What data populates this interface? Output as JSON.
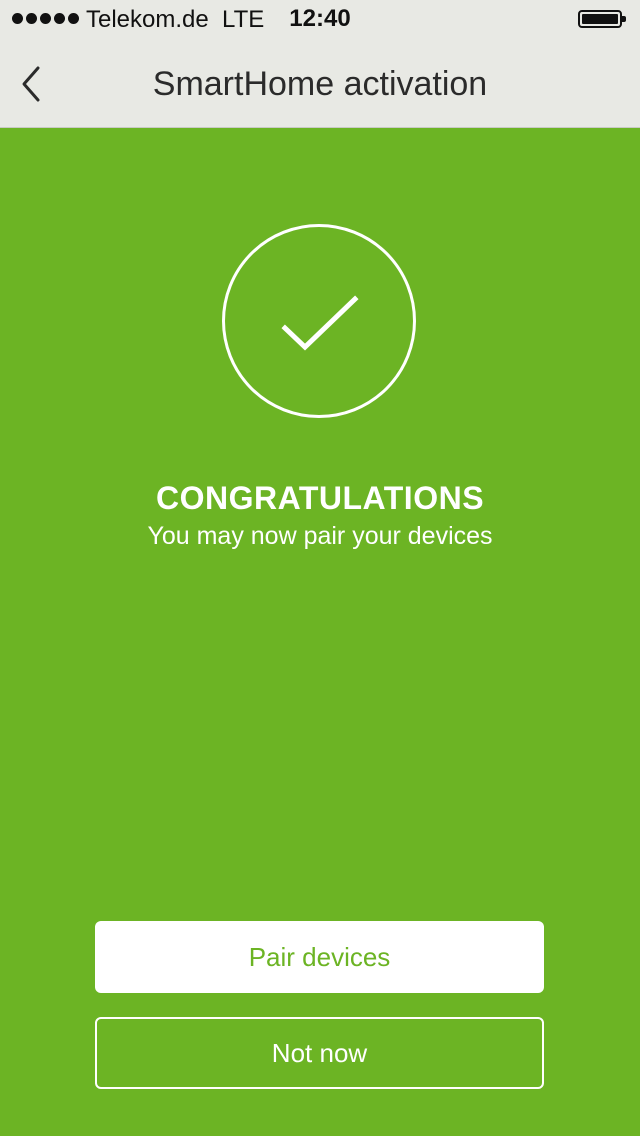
{
  "status_bar": {
    "carrier": "Telekom.de",
    "network": "LTE",
    "time": "12:40",
    "signal_bars": 5,
    "battery_level": 1.0
  },
  "nav": {
    "title": "SmartHome activation",
    "back_icon": "chevron-left-icon"
  },
  "main": {
    "success_icon": "checkmark-circle-icon",
    "headline": "CONGRATULATIONS",
    "subline": "You may now pair your devices"
  },
  "actions": {
    "primary_label": "Pair devices",
    "secondary_label": "Not now"
  },
  "colors": {
    "accent": "#6cb424",
    "nav_background": "#e8e9e4",
    "text_on_accent": "#ffffff"
  }
}
